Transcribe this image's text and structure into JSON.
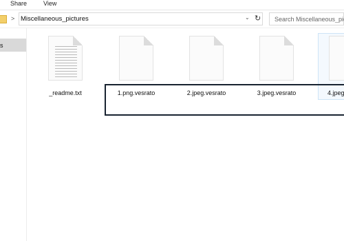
{
  "ribbon": {
    "tabs": [
      {
        "label": "Share"
      },
      {
        "label": "View"
      }
    ]
  },
  "address": {
    "separator": ">",
    "path": "Miscellaneous_pictures"
  },
  "search": {
    "placeholder": "Search Miscellaneous_pictures"
  },
  "navpane": {
    "selected_item_label": "s"
  },
  "files": [
    {
      "name": "_readme.txt",
      "icon": "text-file-icon"
    },
    {
      "name": "1.png.vesrato",
      "icon": "blank-file-icon"
    },
    {
      "name": "2.jpeg.vesrato",
      "icon": "blank-file-icon"
    },
    {
      "name": "3.jpeg.vesrato",
      "icon": "blank-file-icon"
    },
    {
      "name": "4.jpeg",
      "icon": "blank-file-icon"
    }
  ],
  "colors": {
    "highlight_border": "#17222f",
    "selection_bg": "#d9d9d9",
    "folder": "#f3cf6a"
  }
}
